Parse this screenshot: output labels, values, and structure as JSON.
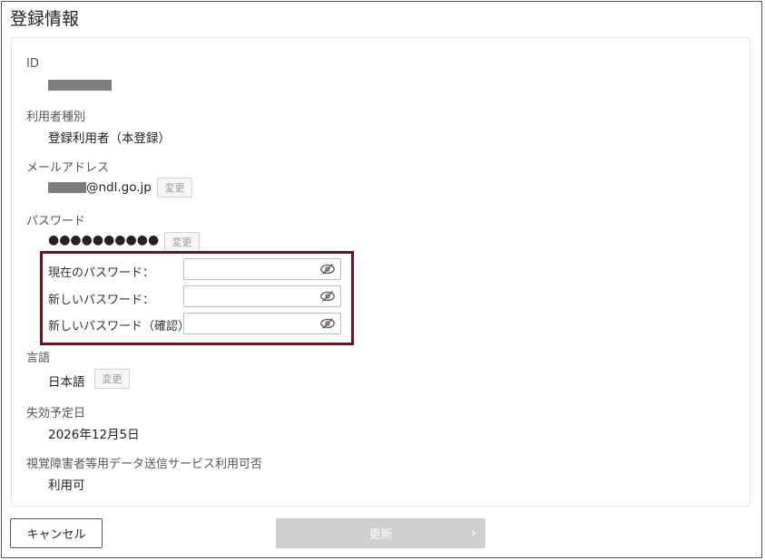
{
  "page": {
    "title": "登録情報"
  },
  "fields": {
    "id": {
      "label": "ID"
    },
    "user_type": {
      "label": "利用者種別",
      "value": "登録利用者（本登録）"
    },
    "email": {
      "label": "メールアドレス",
      "value_suffix": "@ndl.go.jp",
      "change_label": "変更"
    },
    "password": {
      "label": "パスワード",
      "value": "●●●●●●●●●●",
      "change_label": "変更"
    },
    "language": {
      "label": "言語",
      "value": "日本語",
      "change_label": "変更"
    },
    "expiry": {
      "label": "失効予定日",
      "value": "2026年12月5日"
    },
    "accessibility": {
      "label": "視覚障害者等用データ送信サービス利用可否",
      "value": "利用可"
    }
  },
  "password_form": {
    "current": {
      "label": "現在のパスワード：",
      "value": ""
    },
    "new": {
      "label": "新しいパスワード：",
      "value": ""
    },
    "confirm": {
      "label": "新しいパスワード（確認）",
      "value": ""
    }
  },
  "actions": {
    "cancel_label": "キャンセル",
    "update_label": "更新"
  },
  "icons": {
    "eye": "eye-slash-icon",
    "update": "chevron-right-icon"
  },
  "colors": {
    "highlight_border": "#6b1424",
    "update_disabled": "#cfcfcf"
  }
}
